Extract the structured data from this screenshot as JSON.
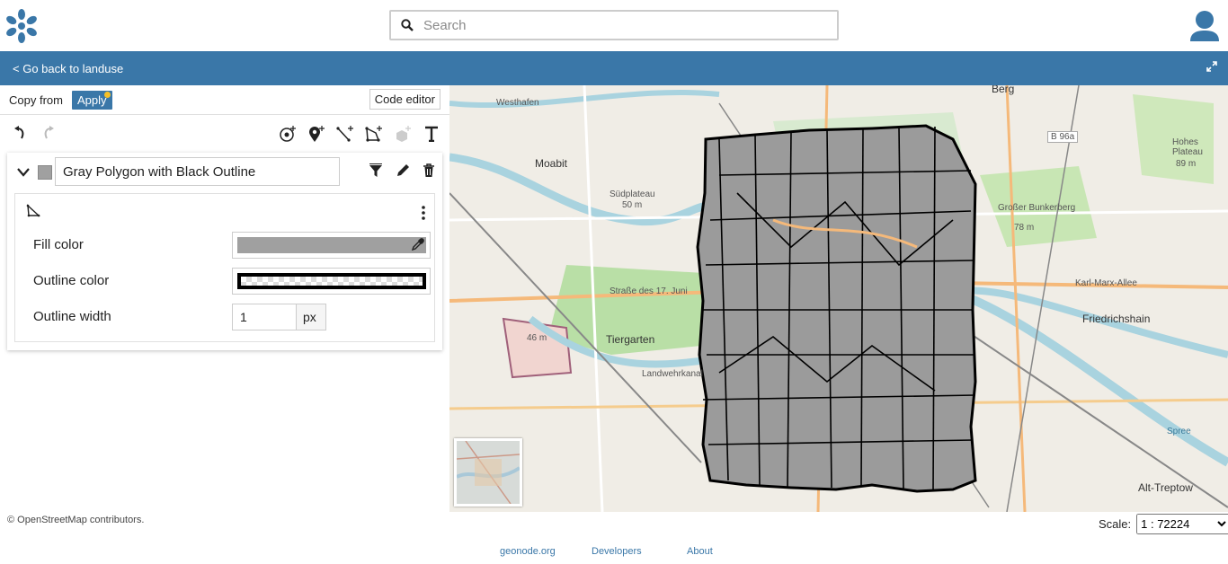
{
  "header": {
    "search_placeholder": "Search",
    "logo_icon": "geonode-logo-icon",
    "avatar_icon": "user-avatar-icon",
    "brand_color": "#3a77a8"
  },
  "breadcrumb": {
    "back_label": "< Go back to landuse",
    "fullscreen_icon": "expand-icon"
  },
  "style_editor": {
    "copy_from_label": "Copy from",
    "apply_label": "Apply",
    "code_editor_label": "Code editor",
    "rule": {
      "name": "Gray Polygon with Black Outline",
      "swatch_color": "#a0a0a0",
      "symbolizer": {
        "fill_color_label": "Fill color",
        "fill_color": "#a0a0a0",
        "outline_color_label": "Outline color",
        "outline_color": "#000000",
        "outline_width_label": "Outline width",
        "outline_width_value": "1",
        "outline_width_unit": "px"
      }
    }
  },
  "map": {
    "labels": [
      {
        "text": "Moabit"
      },
      {
        "text": "Südplateau"
      },
      {
        "text": "50 m"
      },
      {
        "text": "Tiergarten"
      },
      {
        "text": "46 m"
      },
      {
        "text": "Straße des 17. Juni"
      },
      {
        "text": "Landwehrkanal"
      },
      {
        "text": "Westhafen"
      },
      {
        "text": "Berg"
      },
      {
        "text": "B 96a"
      },
      {
        "text": "Hohes Plateau"
      },
      {
        "text": "89 m"
      },
      {
        "text": "Großer Bunkerberg"
      },
      {
        "text": "78 m"
      },
      {
        "text": "Karl-Marx-Allee"
      },
      {
        "text": "Friedrichshain"
      },
      {
        "text": "Alt-Treptow"
      },
      {
        "text": "Spree"
      }
    ]
  },
  "footer": {
    "attribution": "© OpenStreetMap contributors.",
    "scale_label": "Scale:",
    "scale_value": "1 : 72224",
    "links": [
      "geonode.org",
      "Developers",
      "About"
    ]
  }
}
